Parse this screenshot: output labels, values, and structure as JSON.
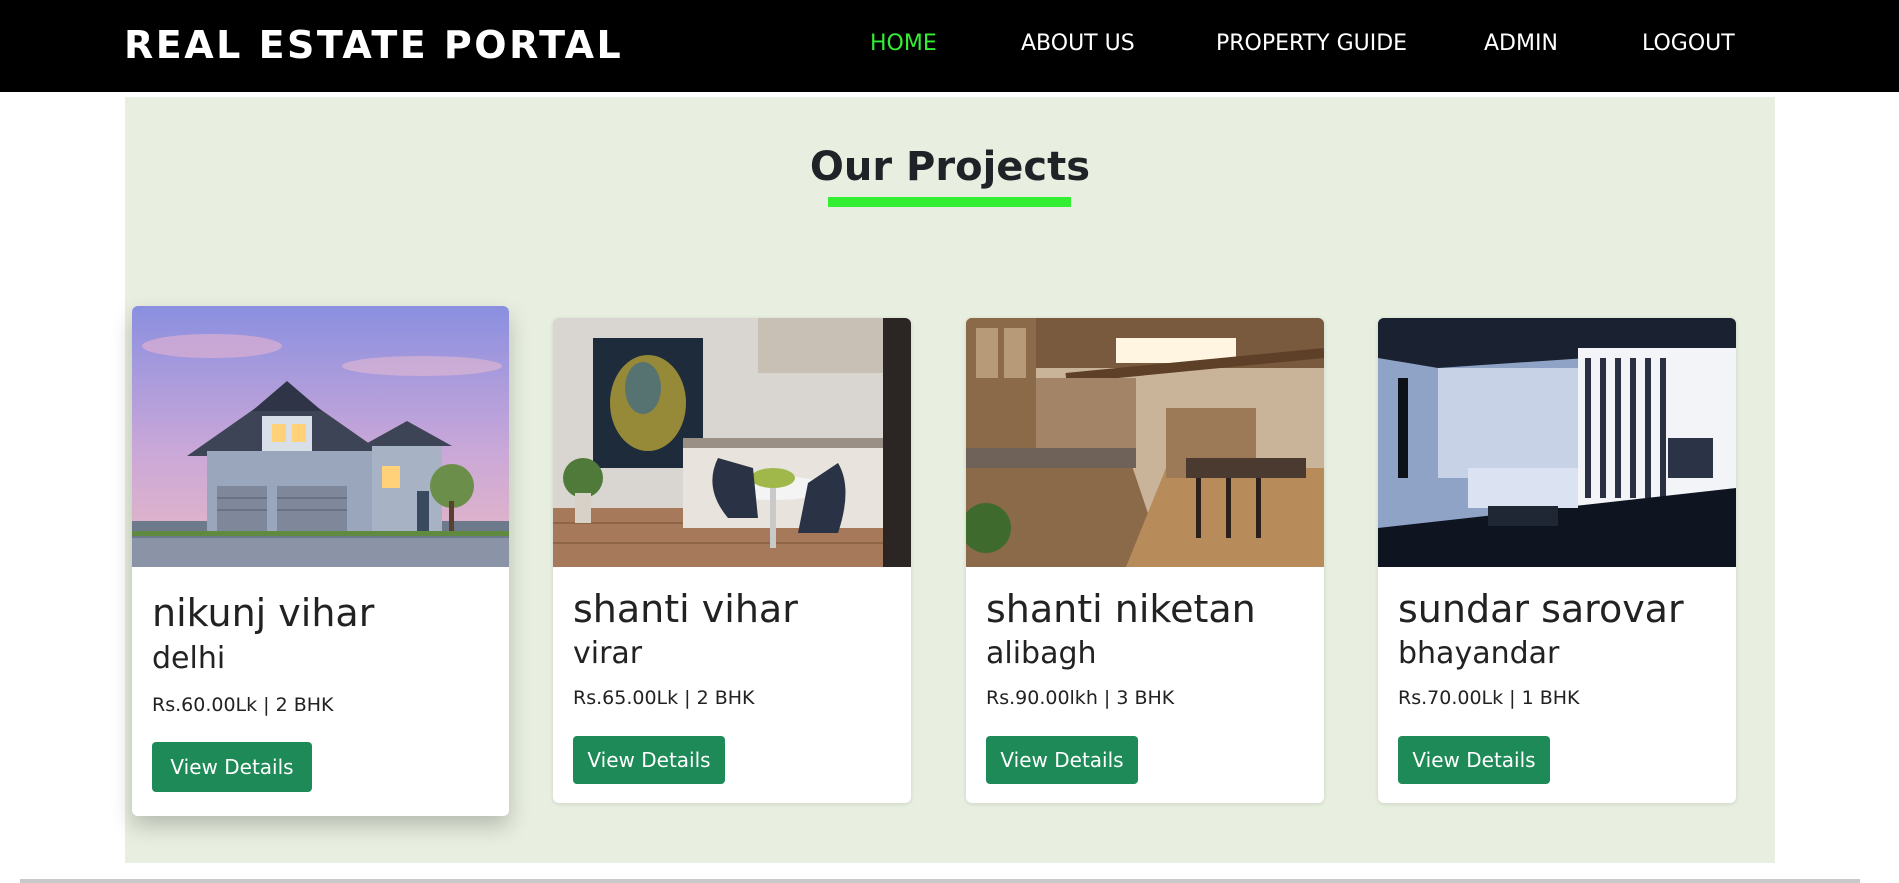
{
  "nav": {
    "brand": "REAL ESTATE PORTAL",
    "items": [
      {
        "label": "HOME",
        "active": true
      },
      {
        "label": "ABOUT US",
        "active": false
      },
      {
        "label": "PROPERTY GUIDE",
        "active": false
      },
      {
        "label": "ADMIN",
        "active": false
      },
      {
        "label": "LOGOUT",
        "active": false
      }
    ]
  },
  "section": {
    "title": "Our Projects"
  },
  "projects": [
    {
      "name": "nikunj vihar",
      "location": "delhi",
      "price": "Rs.60.00Lk | 2 BHK",
      "button": "View Details",
      "image": "house-exterior-icon"
    },
    {
      "name": "shanti vihar",
      "location": "virar",
      "price": "Rs.65.00Lk | 2 BHK",
      "button": "View Details",
      "image": "dining-room-icon"
    },
    {
      "name": "shanti niketan",
      "location": "alibagh",
      "price": "Rs.90.00lkh | 3 BHK",
      "button": "View Details",
      "image": "kitchen-icon"
    },
    {
      "name": "sundar sarovar",
      "location": "bhayandar",
      "price": "Rs.70.00Lk | 1 BHK",
      "button": "View Details",
      "image": "living-room-icon"
    }
  ],
  "colors": {
    "accent": "#33ee33",
    "button": "#1e8a57",
    "section_bg": "#e8efe0",
    "navbar_bg": "#000000"
  }
}
